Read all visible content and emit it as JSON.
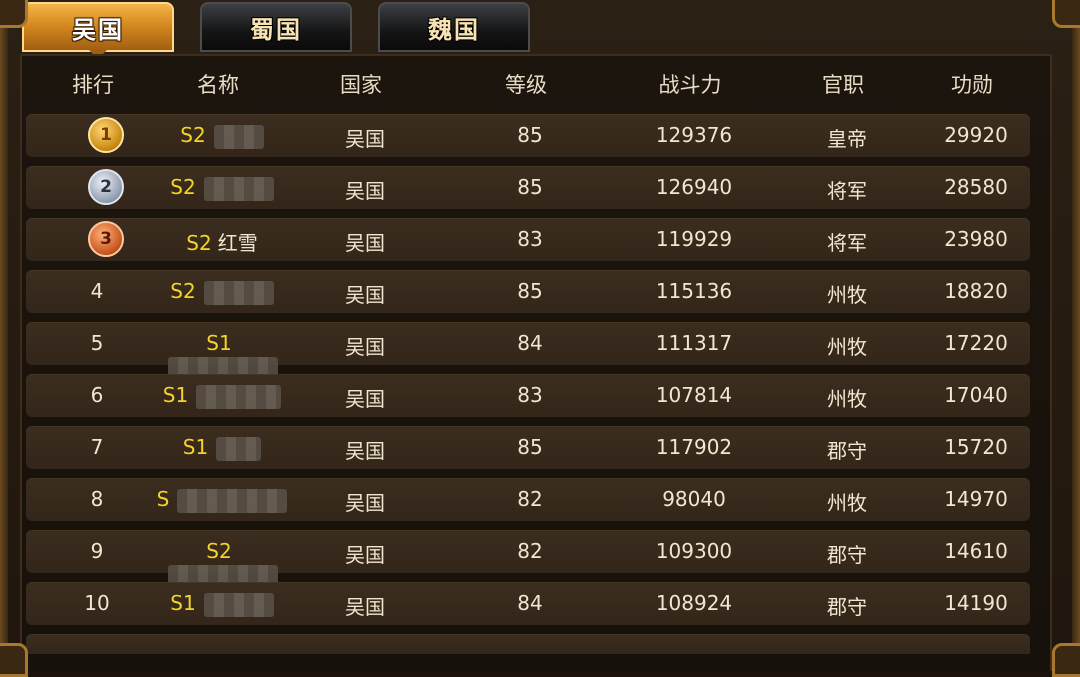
{
  "tabs": [
    {
      "label": "吴国",
      "active": true
    },
    {
      "label": "蜀国",
      "active": false
    },
    {
      "label": "魏国",
      "active": false
    }
  ],
  "headers": {
    "rank": "排行",
    "name": "名称",
    "country": "国家",
    "level": "等级",
    "power": "战斗力",
    "title": "官职",
    "merit": "功勋"
  },
  "rows": [
    {
      "rank": "1",
      "server": "S2",
      "name": "",
      "country": "吴国",
      "level": "85",
      "power": "129376",
      "title": "皇帝",
      "merit": "29920",
      "medal": "gold"
    },
    {
      "rank": "2",
      "server": "S2",
      "name": "",
      "country": "吴国",
      "level": "85",
      "power": "126940",
      "title": "将军",
      "merit": "28580",
      "medal": "silver"
    },
    {
      "rank": "3",
      "server": "S2",
      "name": "红雪",
      "country": "吴国",
      "level": "83",
      "power": "119929",
      "title": "将军",
      "merit": "23980",
      "medal": "bronze"
    },
    {
      "rank": "4",
      "server": "S2",
      "name": "",
      "country": "吴国",
      "level": "85",
      "power": "115136",
      "title": "州牧",
      "merit": "18820"
    },
    {
      "rank": "5",
      "server": "S1",
      "name": "",
      "country": "吴国",
      "level": "84",
      "power": "111317",
      "title": "州牧",
      "merit": "17220"
    },
    {
      "rank": "6",
      "server": "S1",
      "name": "",
      "country": "吴国",
      "level": "83",
      "power": "107814",
      "title": "州牧",
      "merit": "17040"
    },
    {
      "rank": "7",
      "server": "S1",
      "name": "",
      "country": "吴国",
      "level": "85",
      "power": "117902",
      "title": "郡守",
      "merit": "15720"
    },
    {
      "rank": "8",
      "server": "S",
      "name": "",
      "country": "吴国",
      "level": "82",
      "power": "98040",
      "title": "州牧",
      "merit": "14970"
    },
    {
      "rank": "9",
      "server": "S2",
      "name": "",
      "country": "吴国",
      "level": "82",
      "power": "109300",
      "title": "郡守",
      "merit": "14610"
    },
    {
      "rank": "10",
      "server": "S1",
      "name": "",
      "country": "吴国",
      "level": "84",
      "power": "108924",
      "title": "郡守",
      "merit": "14190"
    }
  ]
}
